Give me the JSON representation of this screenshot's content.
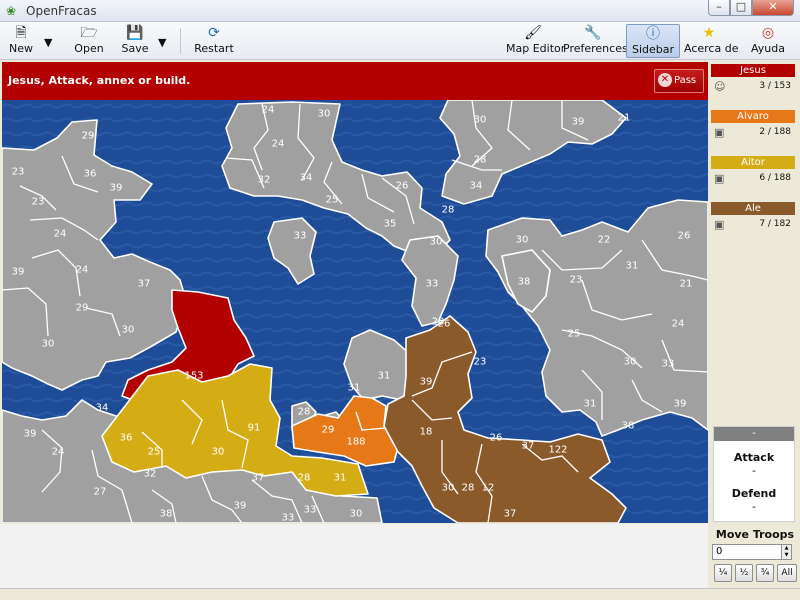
{
  "window": {
    "title": "OpenFracas"
  },
  "toolbar": {
    "new": "New",
    "open": "Open",
    "save": "Save",
    "restart": "Restart",
    "map_editor": "Map Editor",
    "preferences": "Preferences",
    "sidebar": "Sidebar",
    "about": "Acerca de",
    "help": "Ayuda"
  },
  "status": {
    "message": "Jesus, Attack, annex or build.",
    "pass": "Pass"
  },
  "colors": {
    "jesus": "#b20000",
    "alvaro": "#e77817",
    "aitor": "#d4ac14",
    "ale": "#8b5a2b",
    "neutral": "#a0a0a0",
    "sea": "#1f4c96"
  },
  "players": [
    {
      "name": "Jesus",
      "count": "3 / 153",
      "color": "#b20000",
      "type": "human-icon"
    },
    {
      "name": "Alvaro",
      "count": "2 / 188",
      "color": "#e77817",
      "type": "computer-icon"
    },
    {
      "name": "Aitor",
      "count": "6 / 188",
      "color": "#d4ac14",
      "type": "computer-icon"
    },
    {
      "name": "Ale",
      "count": "7 / 182",
      "color": "#8b5a2b",
      "type": "computer-icon"
    }
  ],
  "combat": {
    "header": "-",
    "attack_label": "Attack",
    "attack_value": "-",
    "defend_label": "Defend",
    "defend_value": "-"
  },
  "move": {
    "label": "Move Troops",
    "value": "0",
    "q1": "¼",
    "q2": "½",
    "q3": "¾",
    "all": "All"
  },
  "territories": [
    {
      "n": "29"
    },
    {
      "n": "23"
    },
    {
      "n": "36"
    },
    {
      "n": "39"
    },
    {
      "n": "23"
    },
    {
      "n": "24"
    },
    {
      "n": "39"
    },
    {
      "n": "24"
    },
    {
      "n": "29"
    },
    {
      "n": "30"
    },
    {
      "n": "30"
    },
    {
      "n": "37"
    },
    {
      "n": "24"
    },
    {
      "n": "30"
    },
    {
      "n": "24"
    },
    {
      "n": "32"
    },
    {
      "n": "34"
    },
    {
      "n": "25"
    },
    {
      "n": "26"
    },
    {
      "n": "35"
    },
    {
      "n": "33"
    },
    {
      "n": "30"
    },
    {
      "n": "28"
    },
    {
      "n": "39"
    },
    {
      "n": "21"
    },
    {
      "n": "28"
    },
    {
      "n": "34"
    },
    {
      "n": "28"
    },
    {
      "n": "30"
    },
    {
      "n": "30"
    },
    {
      "n": "22"
    },
    {
      "n": "26"
    },
    {
      "n": "33"
    },
    {
      "n": "38"
    },
    {
      "n": "23"
    },
    {
      "n": "31"
    },
    {
      "n": "21"
    },
    {
      "n": "25"
    },
    {
      "n": "24"
    },
    {
      "n": "30"
    },
    {
      "n": "33"
    },
    {
      "n": "39"
    },
    {
      "n": "31"
    },
    {
      "n": "38"
    },
    {
      "n": "153"
    },
    {
      "n": "26"
    },
    {
      "n": "23"
    },
    {
      "n": "31"
    },
    {
      "n": "39"
    },
    {
      "n": "34"
    },
    {
      "n": "31"
    },
    {
      "n": "28"
    },
    {
      "n": "29"
    },
    {
      "n": "188"
    },
    {
      "n": "18"
    },
    {
      "n": "26"
    },
    {
      "n": "37"
    },
    {
      "n": "122"
    },
    {
      "n": "36"
    },
    {
      "n": "91"
    },
    {
      "n": "39"
    },
    {
      "n": "24"
    },
    {
      "n": "25"
    },
    {
      "n": "30"
    },
    {
      "n": "32"
    },
    {
      "n": "37"
    },
    {
      "n": "28"
    },
    {
      "n": "31"
    },
    {
      "n": "27"
    },
    {
      "n": "38"
    },
    {
      "n": "39"
    },
    {
      "n": "33"
    },
    {
      "n": "30"
    },
    {
      "n": "33"
    },
    {
      "n": "30"
    },
    {
      "n": "28"
    },
    {
      "n": "12"
    },
    {
      "n": "37"
    },
    {
      "n": "31"
    }
  ]
}
